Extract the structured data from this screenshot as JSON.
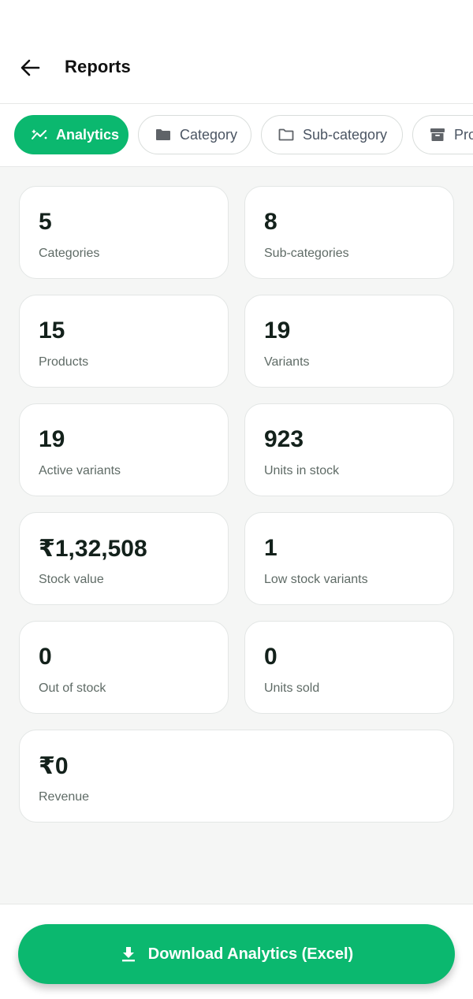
{
  "header": {
    "title": "Reports"
  },
  "tabs": [
    {
      "label": "Analytics",
      "icon": "analytics-trend-icon",
      "active": true
    },
    {
      "label": "Category",
      "icon": "folder-filled-icon",
      "active": false
    },
    {
      "label": "Sub-category",
      "icon": "folder-outline-icon",
      "active": false
    },
    {
      "label": "Pro",
      "icon": "archive-box-icon",
      "active": false
    }
  ],
  "stats": [
    {
      "value": "5",
      "label": "Categories"
    },
    {
      "value": "8",
      "label": "Sub-categories"
    },
    {
      "value": "15",
      "label": "Products"
    },
    {
      "value": "19",
      "label": "Variants"
    },
    {
      "value": "19",
      "label": "Active variants"
    },
    {
      "value": "923",
      "label": "Units in stock"
    },
    {
      "value": "₹1,32,508",
      "label": "Stock value"
    },
    {
      "value": "1",
      "label": "Low stock variants"
    },
    {
      "value": "0",
      "label": "Out of stock"
    },
    {
      "value": "0",
      "label": "Units sold"
    },
    {
      "value": "₹0",
      "label": "Revenue"
    }
  ],
  "footer": {
    "download_label": "Download Analytics (Excel)",
    "download_icon": "download-icon"
  },
  "colors": {
    "accent": "#0bb86f",
    "background": "#f5f6f5",
    "card": "#ffffff",
    "text_primary": "#13211b",
    "text_secondary": "#5f6b66"
  }
}
